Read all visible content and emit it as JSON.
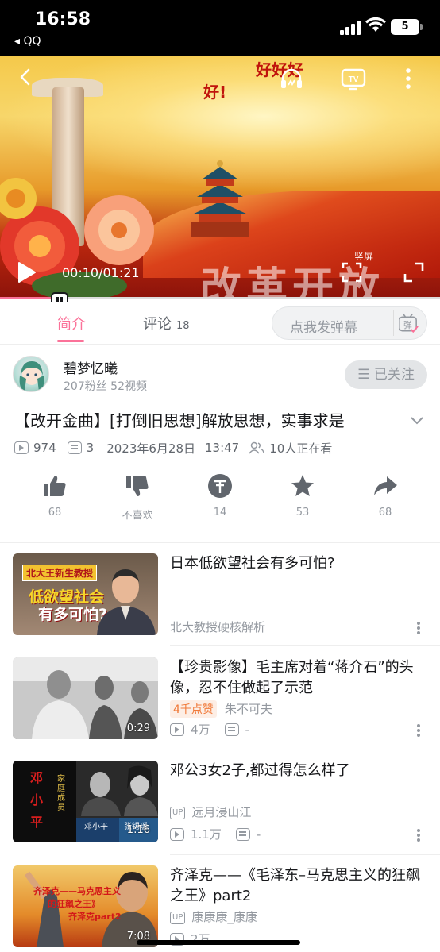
{
  "status_bar": {
    "time": "16:58",
    "back_app": "◂ QQ",
    "battery": "5"
  },
  "player": {
    "danmaku": [
      "好!",
      "好好好"
    ],
    "overlay_text": "改革开放",
    "time": "00:10/01:21",
    "vertical_label": "竖屏",
    "progress": 0.123
  },
  "tabs": {
    "intro": "简介",
    "comments": "评论",
    "comment_count": "18",
    "danmu_placeholder": "点我发弹幕",
    "danmu_toggle": "弹"
  },
  "uploader": {
    "name": "碧梦忆曦",
    "stats": "207粉丝  52视频",
    "follow_label": "☰ 已关注"
  },
  "video": {
    "title": "【改开金曲】[打倒旧思想]解放思想，实事求是",
    "views": "974",
    "danmaku_count": "3",
    "date": "2023年6月28日",
    "time": "13:47",
    "watching": "10人正在看"
  },
  "actions": [
    {
      "icon": "thumb-up-icon",
      "label": "68"
    },
    {
      "icon": "thumb-down-icon",
      "label": "不喜欢"
    },
    {
      "icon": "coin-icon",
      "label": "14"
    },
    {
      "icon": "star-icon",
      "label": "53"
    },
    {
      "icon": "share-icon",
      "label": "68"
    }
  ],
  "recommendations": [
    {
      "title": "日本低欲望社会有多可怕?",
      "author": "北大教授硬核解析",
      "thumb_text": [
        "北大王新生教授",
        "低欲望社会",
        "有多可怕?"
      ]
    },
    {
      "title": "【珍贵影像】毛主席对着“蒋介石”的头像，忍不住做起了示范",
      "hot": "4千点赞",
      "author": "朱不可夫",
      "views": "4万",
      "danmaku": "-",
      "duration": "0:29"
    },
    {
      "title": "邓公3女2子,都过得怎么样了",
      "author": "远月浸山江",
      "views": "1.1万",
      "danmaku": "-",
      "duration": "1:16",
      "thumb_text": [
        "邓",
        "小",
        "平",
        "家庭成员",
        "邓小平",
        "张锡瑗"
      ]
    },
    {
      "title": "齐泽克——《毛泽东–马克思主义的狂飙之王》part2",
      "author": "康康康_康康",
      "views": "2万",
      "duration": "7:08",
      "thumb_text": [
        "齐泽克——马克思主义",
        "的狂飙之王》",
        "齐泽克part2"
      ]
    }
  ],
  "colors": {
    "accent": "#fb7299",
    "muted": "#9499a0"
  }
}
